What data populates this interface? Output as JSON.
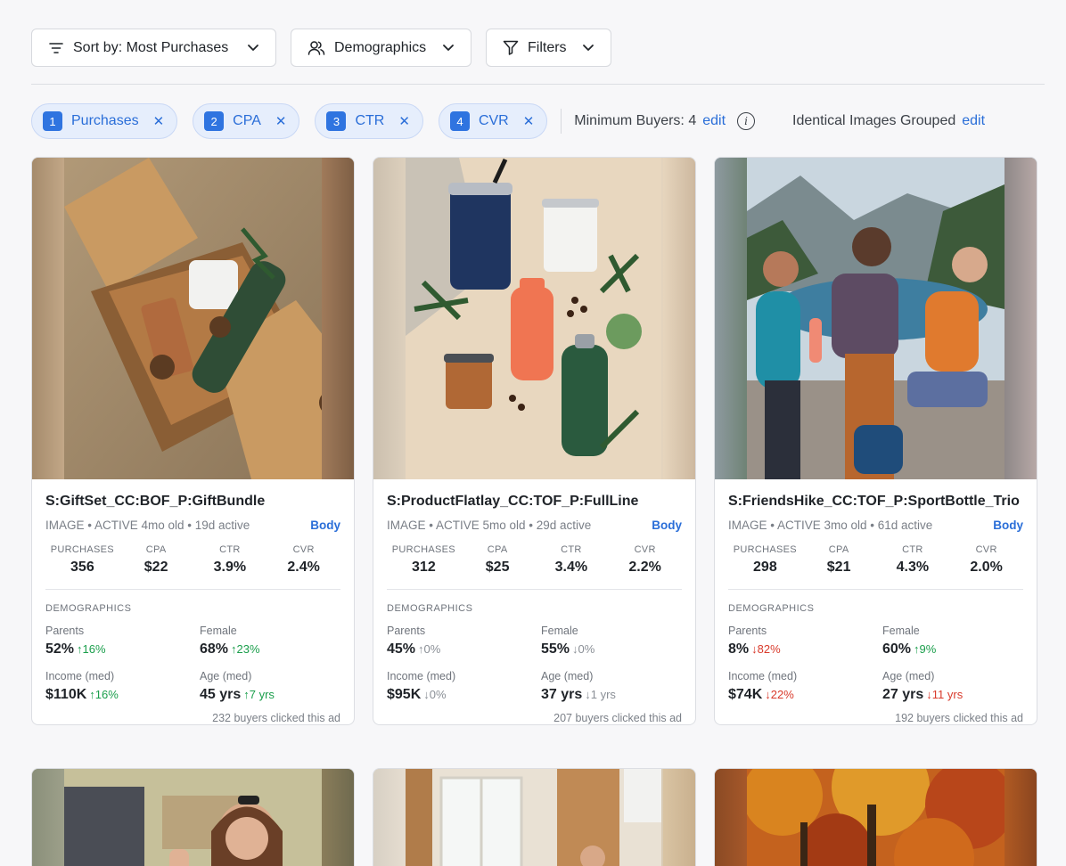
{
  "toolbar": {
    "sort_label": "Sort by: Most Purchases",
    "demographics_label": "Demographics",
    "filters_label": "Filters"
  },
  "chips": [
    {
      "num": "1",
      "label": "Purchases"
    },
    {
      "num": "2",
      "label": "CPA"
    },
    {
      "num": "3",
      "label": "CTR"
    },
    {
      "num": "4",
      "label": "CVR"
    }
  ],
  "settings": {
    "min_buyers": "Minimum Buyers: 4",
    "edit": "edit",
    "grouped": "Identical Images Grouped",
    "info": "i"
  },
  "labels": {
    "purchases": "PURCHASES",
    "cpa": "CPA",
    "ctr": "CTR",
    "cvr": "CVR",
    "demographics": "DEMOGRAPHICS",
    "parents": "Parents",
    "female": "Female",
    "income": "Income (med)",
    "age": "Age (med)",
    "body": "Body"
  },
  "cards": [
    {
      "title": "S:GiftSet_CC:BOF_P:GiftBundle",
      "meta": "IMAGE • ACTIVE 4mo old • 19d active",
      "purchases": "356",
      "cpa": "$22",
      "ctr": "3.9%",
      "cvr": "2.4%",
      "parents": "52%",
      "parents_delta": "↑16%",
      "female": "68%",
      "female_delta": "↑23%",
      "income": "$110K",
      "income_delta": "↑16%",
      "age": "45 yrs",
      "age_delta": "↑7 yrs",
      "buyers": "232 buyers clicked this ad"
    },
    {
      "title": "S:ProductFlatlay_CC:TOF_P:FullLine",
      "meta": "IMAGE • ACTIVE 5mo old • 29d active",
      "purchases": "312",
      "cpa": "$25",
      "ctr": "3.4%",
      "cvr": "2.2%",
      "parents": "45%",
      "parents_delta": "↑0%",
      "female": "55%",
      "female_delta": "↓0%",
      "income": "$95K",
      "income_delta": "↓0%",
      "age": "37 yrs",
      "age_delta": "↓1 yrs",
      "buyers": "207 buyers clicked this ad"
    },
    {
      "title": "S:FriendsHike_CC:TOF_P:SportBottle_Trio",
      "meta": "IMAGE • ACTIVE 3mo old • 61d active",
      "purchases": "298",
      "cpa": "$21",
      "ctr": "4.3%",
      "cvr": "2.0%",
      "parents": "8%",
      "parents_delta": "↓82%",
      "female": "60%",
      "female_delta": "↑9%",
      "income": "$74K",
      "income_delta": "↓22%",
      "age": "27 yrs",
      "age_delta": "↓11 yrs",
      "buyers": "192 buyers clicked this ad"
    }
  ]
}
